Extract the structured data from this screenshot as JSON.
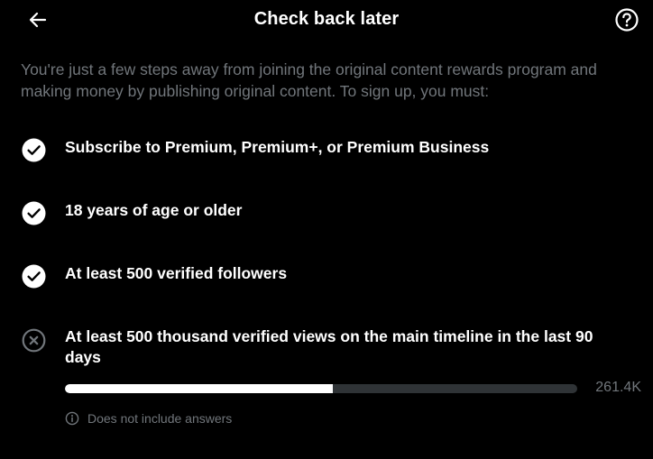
{
  "header": {
    "title": "Check back later",
    "back_icon": "arrow-left-icon",
    "help_icon": "question-circle-icon"
  },
  "intro": "You're just a few steps away from joining the original content rewards program and making money by publishing original content. To sign up, you must:",
  "requirements": [
    {
      "label": "Subscribe to Premium, Premium+, or Premium Business",
      "met": true,
      "icon": "check-circle-icon"
    },
    {
      "label": "18 years of age or older",
      "met": true,
      "icon": "check-circle-icon"
    },
    {
      "label": "At least 500 verified followers",
      "met": true,
      "icon": "check-circle-icon"
    },
    {
      "label": "At least 500 thousand verified views on the main timeline in the last 90 days",
      "met": false,
      "icon": "x-circle-icon"
    }
  ],
  "views_progress": {
    "value_label": "261.4K",
    "fraction": 0.5228
  },
  "note": {
    "text": "Does not include answers",
    "icon": "info-icon"
  },
  "colors": {
    "background": "#000000",
    "text_primary": "#ffffff",
    "text_secondary": "#71767b",
    "track": "#2f3336",
    "icon_unmet": "#71767b"
  }
}
